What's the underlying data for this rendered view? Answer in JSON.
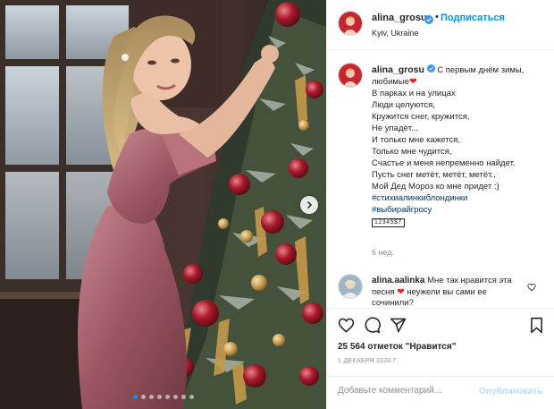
{
  "colors": {
    "accent": "#0095f6",
    "publish_disabled": "#b2dffc",
    "heart_red": "#ed1c24",
    "hashtag": "#00376b",
    "muted": "#8e8e8e"
  },
  "header": {
    "username": "alina_grosu",
    "separator": "•",
    "follow_label": "Подписаться",
    "location": "Kyiv, Ukraine",
    "verified_icon": "verified-badge-icon"
  },
  "caption": {
    "username": "alina_grosu",
    "lines": [
      "С первым днём зимы,",
      "любимые",
      "В парках и на улицах",
      "Люди целуются,",
      "Кружится снег, кружится,",
      "Не упадёт...",
      "И только мне кажется,",
      "Только мне чудится,",
      "Счастье и меня непременно найдет.",
      "Пусть снег метёт, метёт, метёт..",
      "Мой Дед Мороз ко мне придет :)"
    ],
    "hashtags": [
      "#стихиалинкиблондинки",
      "#выбирайгросу"
    ],
    "tag_label": "12345$7",
    "time": "6 нед."
  },
  "comment": {
    "username": "alina.aalinka",
    "text_before": "Мне так нравится эта песня",
    "text_after": "неужели вы сами ее сочинили?"
  },
  "photo": {
    "slides_total": 8,
    "active_slide": 1
  },
  "actions": {
    "icons": [
      "heart-icon",
      "comment-icon",
      "share-icon",
      "bookmark-icon"
    ],
    "likes": "25 564 отметок \"Нравится\"",
    "date": "1 ДЕКАБРЯ 2020 Г."
  },
  "comment_box": {
    "placeholder": "Добавьте комментарий...",
    "publish_label": "Опубликовать"
  }
}
